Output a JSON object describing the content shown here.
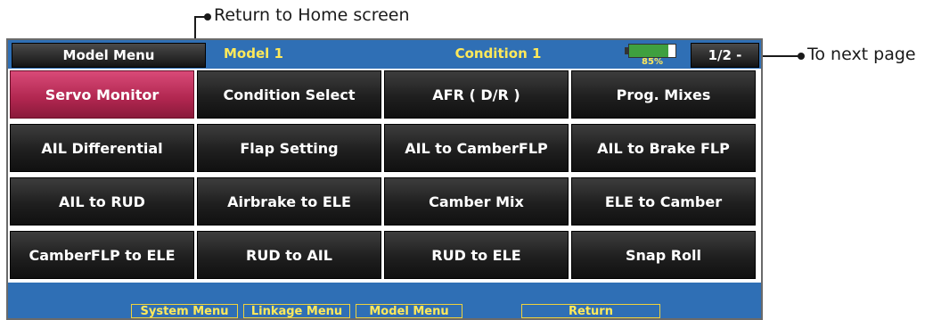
{
  "annotations": {
    "return_home": "Return to Home screen",
    "next_page": "To next page"
  },
  "header": {
    "menu_button": "Model Menu",
    "model_name": "Model 1",
    "condition": "Condition 1",
    "battery_percent": "85%",
    "battery_level": 0.85,
    "page_button": "1/2 -"
  },
  "grid": {
    "items": [
      "Servo Monitor",
      "Condition Select",
      "AFR ( D/R )",
      "Prog.  Mixes",
      "AIL  Differential",
      "Flap  Setting",
      "AIL to CamberFLP",
      "AIL to Brake FLP",
      "AIL to RUD",
      "Airbrake to ELE",
      "Camber Mix",
      "ELE to Camber",
      "CamberFLP to ELE",
      "RUD to AIL",
      "RUD to ELE",
      "Snap  Roll"
    ]
  },
  "footer": {
    "system_menu": "System  Menu",
    "linkage_menu": "Linkage  Menu",
    "model_menu": "Model  Menu",
    "return": "Return"
  },
  "colors": {
    "header_bg": "#2f6fb5",
    "highlight_text": "#ffe95a",
    "active_cell": "#b0264f",
    "cell_bg": "#1f1f1f"
  }
}
